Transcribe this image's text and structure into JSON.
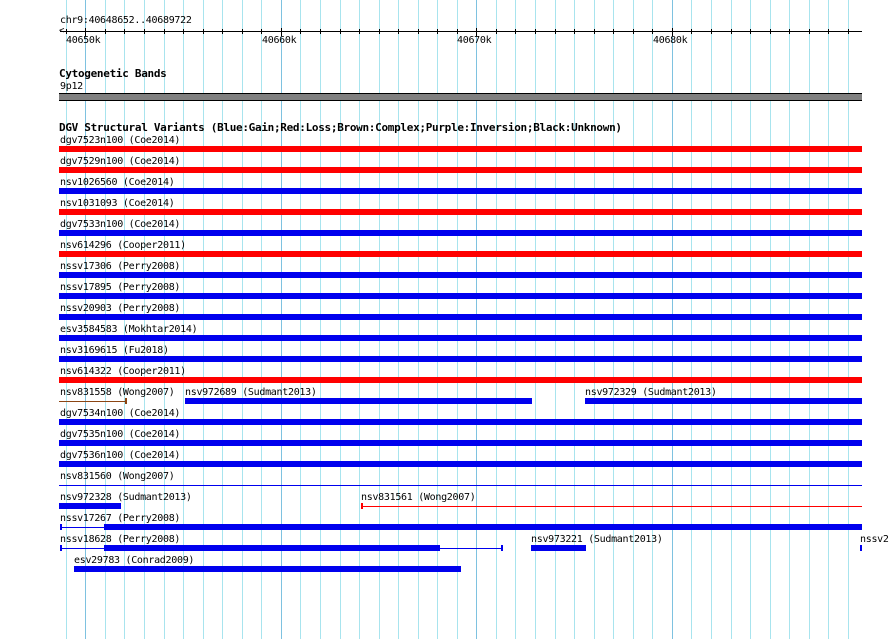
{
  "ruler": {
    "location": "chr9:40648652..40689722",
    "start": 40648652,
    "end": 40689722,
    "major_labels": [
      {
        "pos": 40650000,
        "label": "40650k"
      },
      {
        "pos": 40660000,
        "label": "40660k"
      },
      {
        "pos": 40670000,
        "label": "40670k"
      },
      {
        "pos": 40680000,
        "label": "40680k"
      }
    ]
  },
  "cyto_track": {
    "title": "Cytogenetic Bands",
    "band": "9p12",
    "band_color": "#808080"
  },
  "dgv_track": {
    "title": "DGV Structural Variants (Blue:Gain;Red:Loss;Brown:Complex;Purple:Inversion;Black:Unknown)",
    "colors": {
      "gain": "#0000ee",
      "loss": "#ff0000",
      "complex": "#8b4513"
    },
    "rows": [
      [
        {
          "label": "dgv7523n100 (Coe2014)",
          "type": "loss",
          "start": 40648652,
          "end": 40689722
        }
      ],
      [
        {
          "label": "dgv7529n100 (Coe2014)",
          "type": "loss",
          "start": 40648652,
          "end": 40689722
        }
      ],
      [
        {
          "label": "nsv1026560 (Coe2014)",
          "type": "gain",
          "start": 40648652,
          "end": 40689722
        }
      ],
      [
        {
          "label": "nsv1031093 (Coe2014)",
          "type": "loss",
          "start": 40648652,
          "end": 40689722
        }
      ],
      [
        {
          "label": "dgv7533n100 (Coe2014)",
          "type": "gain",
          "start": 40648652,
          "end": 40689722
        }
      ],
      [
        {
          "label": "nsv614296 (Cooper2011)",
          "type": "loss",
          "start": 40648652,
          "end": 40689722
        }
      ],
      [
        {
          "label": "nssv17306 (Perry2008)",
          "type": "gain",
          "start": 40648652,
          "end": 40689722
        }
      ],
      [
        {
          "label": "nssv17895 (Perry2008)",
          "type": "gain",
          "start": 40648652,
          "end": 40689722
        }
      ],
      [
        {
          "label": "nssv20903 (Perry2008)",
          "type": "gain",
          "start": 40648652,
          "end": 40689722
        }
      ],
      [
        {
          "label": "esv3584583 (Mokhtar2014)",
          "type": "gain",
          "start": 40648652,
          "end": 40689722
        }
      ],
      [
        {
          "label": "nsv3169615 (Fu2018)",
          "type": "gain",
          "start": 40648652,
          "end": 40689722
        }
      ],
      [
        {
          "label": "nsv614322 (Cooper2011)",
          "type": "loss",
          "start": 40648652,
          "end": 40689722
        }
      ],
      [
        {
          "label": "nsv831558 (Wong2007)",
          "type": "complex",
          "style": "line",
          "start": 40648652,
          "end": 40652130
        },
        {
          "label": "nsv972689 (Sudmant2013)",
          "type": "gain",
          "start": 40655097,
          "end": 40672846
        },
        {
          "label": "nsv972329 (Sudmant2013)",
          "type": "gain",
          "start": 40675557,
          "end": 40689722
        }
      ],
      [
        {
          "label": "dgv7534n100 (Coe2014)",
          "type": "gain",
          "start": 40648652,
          "end": 40689722
        }
      ],
      [
        {
          "label": "dgv7535n100 (Coe2014)",
          "type": "gain",
          "start": 40648652,
          "end": 40689722
        }
      ],
      [
        {
          "label": "dgv7536n100 (Coe2014)",
          "type": "gain",
          "start": 40648652,
          "end": 40689722
        }
      ],
      [
        {
          "label": "nsv831560 (Wong2007)",
          "type": "gain",
          "style": "line",
          "start": 40648652,
          "end": 40689722
        }
      ],
      [
        {
          "label": "nsv972328 (Sudmant2013)",
          "type": "gain",
          "start": 40648652,
          "end": 40651823
        },
        {
          "label": "nsv831561 (Wong2007)",
          "type": "loss",
          "style": "line",
          "start": 40664100,
          "end": 40689722
        }
      ],
      [
        {
          "label": "nssv17267 (Perry2008)",
          "type": "gain",
          "style": "outer",
          "start": 40648703,
          "end": 40689722,
          "inner_start": 40650954,
          "inner_end": 40689722
        }
      ],
      [
        {
          "label": "nssv18628 (Perry2008)",
          "type": "gain",
          "style": "outer",
          "start": 40648703,
          "end": 40671312,
          "inner_start": 40650954,
          "inner_end": 40668140
        },
        {
          "label": "nsv973221 (Sudmant2013)",
          "type": "gain",
          "start": 40672795,
          "end": 40675609
        },
        {
          "label": "nssv2",
          "type": "gain",
          "start": 40689623,
          "end": 40689722
        }
      ],
      [
        {
          "label": "esv29783 (Conrad2009)",
          "type": "gain",
          "start": 40649419,
          "end": 40669215
        }
      ]
    ]
  }
}
